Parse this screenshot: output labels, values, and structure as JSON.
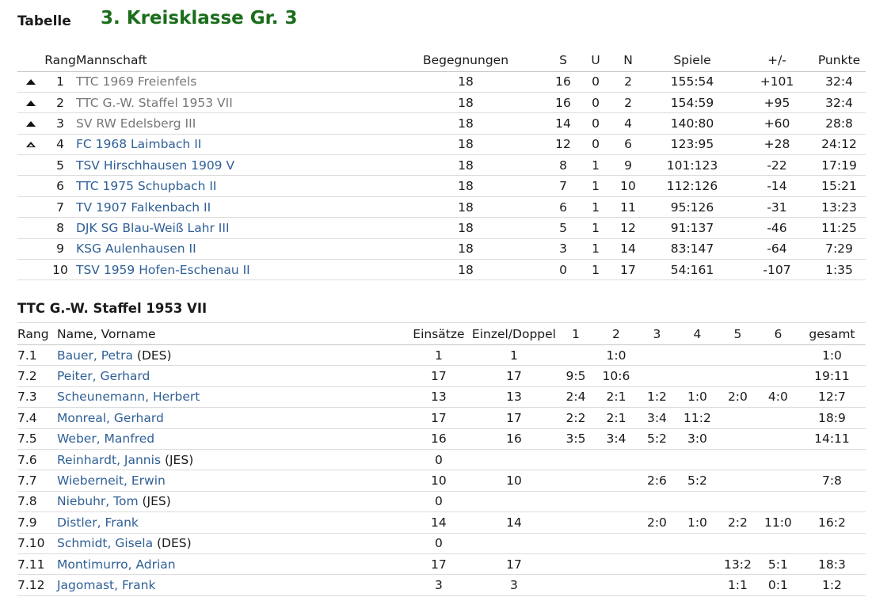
{
  "page": {
    "label": "Tabelle",
    "title": "3. Kreisklasse Gr. 3",
    "section_title": "TTC G.-W. Staffel 1953 VII"
  },
  "colors": {
    "title": "#1b6d1b",
    "link": "#2f5f96",
    "muted": "#777777"
  },
  "standings": {
    "headers": {
      "rang": "Rang",
      "mannschaft": "Mannschaft",
      "begegnungen": "Begegnungen",
      "s": "S",
      "u": "U",
      "n": "N",
      "spiele": "Spiele",
      "diff": "+/-",
      "punkte": "Punkte"
    },
    "rows": [
      {
        "marker": "promotion-icon",
        "rang": "1",
        "mannschaft": "TTC 1969 Freienfels",
        "begegnungen": "18",
        "s": "16",
        "u": "0",
        "n": "2",
        "spiele": "155:54",
        "diff": "+101",
        "punkte": "32:4"
      },
      {
        "marker": "promotion-icon",
        "rang": "2",
        "mannschaft": "TTC G.-W. Staffel 1953 VII",
        "begegnungen": "18",
        "s": "16",
        "u": "0",
        "n": "2",
        "spiele": "154:59",
        "diff": "+95",
        "punkte": "32:4"
      },
      {
        "marker": "promotion-icon",
        "rang": "3",
        "mannschaft": "SV RW Edelsberg III",
        "begegnungen": "18",
        "s": "14",
        "u": "0",
        "n": "4",
        "spiele": "140:80",
        "diff": "+60",
        "punkte": "28:8"
      },
      {
        "marker": "relegation-up-icon",
        "rang": "4",
        "mannschaft": "FC 1968 Laimbach II",
        "begegnungen": "18",
        "s": "12",
        "u": "0",
        "n": "6",
        "spiele": "123:95",
        "diff": "+28",
        "punkte": "24:12"
      },
      {
        "marker": "",
        "rang": "5",
        "mannschaft": "TSV Hirschhausen 1909 V",
        "begegnungen": "18",
        "s": "8",
        "u": "1",
        "n": "9",
        "spiele": "101:123",
        "diff": "-22",
        "punkte": "17:19"
      },
      {
        "marker": "",
        "rang": "6",
        "mannschaft": "TTC 1975 Schupbach II",
        "begegnungen": "18",
        "s": "7",
        "u": "1",
        "n": "10",
        "spiele": "112:126",
        "diff": "-14",
        "punkte": "15:21"
      },
      {
        "marker": "",
        "rang": "7",
        "mannschaft": "TV 1907 Falkenbach II",
        "begegnungen": "18",
        "s": "6",
        "u": "1",
        "n": "11",
        "spiele": "95:126",
        "diff": "-31",
        "punkte": "13:23"
      },
      {
        "marker": "",
        "rang": "8",
        "mannschaft": "DJK SG Blau-Weiß Lahr III",
        "begegnungen": "18",
        "s": "5",
        "u": "1",
        "n": "12",
        "spiele": "91:137",
        "diff": "-46",
        "punkte": "11:25"
      },
      {
        "marker": "",
        "rang": "9",
        "mannschaft": "KSG Aulenhausen II",
        "begegnungen": "18",
        "s": "3",
        "u": "1",
        "n": "14",
        "spiele": "83:147",
        "diff": "-64",
        "punkte": "7:29"
      },
      {
        "marker": "",
        "rang": "10",
        "mannschaft": "TSV 1959 Hofen-Eschenau II",
        "begegnungen": "18",
        "s": "0",
        "u": "1",
        "n": "17",
        "spiele": "54:161",
        "diff": "-107",
        "punkte": "1:35"
      }
    ]
  },
  "players": {
    "headers": {
      "rang": "Rang",
      "name": "Name, Vorname",
      "einsaetze": "Einsätze",
      "einzel": "Einzel/Doppel",
      "p1": "1",
      "p2": "2",
      "p3": "3",
      "p4": "4",
      "p5": "5",
      "p6": "6",
      "gesamt": "gesamt"
    },
    "rows": [
      {
        "rang": "7.1",
        "name": "Bauer, Petra",
        "suffix": " (DES)",
        "einsaetze": "1",
        "einzel": "1",
        "p1": "",
        "p2": "1:0",
        "p3": "",
        "p4": "",
        "p5": "",
        "p6": "",
        "gesamt": "1:0"
      },
      {
        "rang": "7.2",
        "name": "Peiter, Gerhard",
        "suffix": "",
        "einsaetze": "17",
        "einzel": "17",
        "p1": "9:5",
        "p2": "10:6",
        "p3": "",
        "p4": "",
        "p5": "",
        "p6": "",
        "gesamt": "19:11"
      },
      {
        "rang": "7.3",
        "name": "Scheunemann, Herbert",
        "suffix": "",
        "einsaetze": "13",
        "einzel": "13",
        "p1": "2:4",
        "p2": "2:1",
        "p3": "1:2",
        "p4": "1:0",
        "p5": "2:0",
        "p6": "4:0",
        "gesamt": "12:7"
      },
      {
        "rang": "7.4",
        "name": "Monreal, Gerhard",
        "suffix": "",
        "einsaetze": "17",
        "einzel": "17",
        "p1": "2:2",
        "p2": "2:1",
        "p3": "3:4",
        "p4": "11:2",
        "p5": "",
        "p6": "",
        "gesamt": "18:9"
      },
      {
        "rang": "7.5",
        "name": "Weber, Manfred",
        "suffix": "",
        "einsaetze": "16",
        "einzel": "16",
        "p1": "3:5",
        "p2": "3:4",
        "p3": "5:2",
        "p4": "3:0",
        "p5": "",
        "p6": "",
        "gesamt": "14:11"
      },
      {
        "rang": "7.6",
        "name": "Reinhardt, Jannis",
        "suffix": " (JES)",
        "einsaetze": "0",
        "einzel": "",
        "p1": "",
        "p2": "",
        "p3": "",
        "p4": "",
        "p5": "",
        "p6": "",
        "gesamt": ""
      },
      {
        "rang": "7.7",
        "name": "Wieberneit, Erwin",
        "suffix": "",
        "einsaetze": "10",
        "einzel": "10",
        "p1": "",
        "p2": "",
        "p3": "2:6",
        "p4": "5:2",
        "p5": "",
        "p6": "",
        "gesamt": "7:8"
      },
      {
        "rang": "7.8",
        "name": "Niebuhr, Tom",
        "suffix": " (JES)",
        "einsaetze": "0",
        "einzel": "",
        "p1": "",
        "p2": "",
        "p3": "",
        "p4": "",
        "p5": "",
        "p6": "",
        "gesamt": ""
      },
      {
        "rang": "7.9",
        "name": "Distler, Frank",
        "suffix": "",
        "einsaetze": "14",
        "einzel": "14",
        "p1": "",
        "p2": "",
        "p3": "2:0",
        "p4": "1:0",
        "p5": "2:2",
        "p6": "11:0",
        "gesamt": "16:2"
      },
      {
        "rang": "7.10",
        "name": "Schmidt, Gisela",
        "suffix": " (DES)",
        "einsaetze": "0",
        "einzel": "",
        "p1": "",
        "p2": "",
        "p3": "",
        "p4": "",
        "p5": "",
        "p6": "",
        "gesamt": ""
      },
      {
        "rang": "7.11",
        "name": "Montimurro, Adrian",
        "suffix": "",
        "einsaetze": "17",
        "einzel": "17",
        "p1": "",
        "p2": "",
        "p3": "",
        "p4": "",
        "p5": "13:2",
        "p6": "5:1",
        "gesamt": "18:3"
      },
      {
        "rang": "7.12",
        "name": "Jagomast, Frank",
        "suffix": "",
        "einsaetze": "3",
        "einzel": "3",
        "p1": "",
        "p2": "",
        "p3": "",
        "p4": "",
        "p5": "1:1",
        "p6": "0:1",
        "gesamt": "1:2"
      }
    ]
  }
}
